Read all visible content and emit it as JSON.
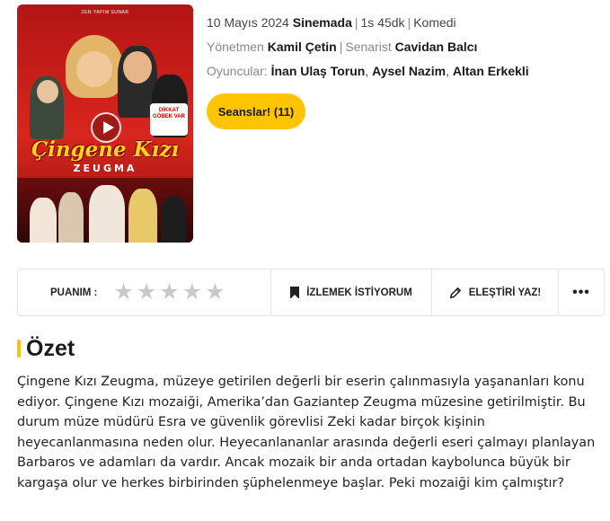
{
  "poster": {
    "title": "Çingene Kızı",
    "subtitle": "ZEUGMA",
    "top_text": "ZEN YAPIM SUNAR",
    "sign_text": "DİKKAT GÖBEK VAR"
  },
  "meta": {
    "date": "10 Mayıs 2024",
    "status": "Sinemada",
    "duration": "1s 45dk",
    "genre": "Komedi",
    "director_label": "Yönetmen",
    "director": "Kamil Çetin",
    "writer_label": "Senarist",
    "writer": "Cavidan Balcı",
    "cast_label": "Oyuncular:",
    "cast": [
      "İnan Ulaş Torun",
      "Aysel Nazim",
      "Altan Erkekli"
    ]
  },
  "showtimes_button": "Seanslar! (11)",
  "actionbar": {
    "rating_label": "PUANIM :",
    "stars": 5,
    "rating_value": 0,
    "watchlist_label": "İZLEMEK İSTİYORUM",
    "review_label": "ELEŞTİRİ YAZ!",
    "more_label": "•••"
  },
  "summary": {
    "heading": "Özet",
    "text": "Çingene Kızı Zeugma, müzeye getirilen değerli bir eserin çalınmasıyla yaşananları konu ediyor. Çingene Kızı mozaiği, Amerika’dan Gaziantep Zeugma müzesine getirilmiştir. Bu durum müze müdürü Esra ve güvenlik görevlisi Zeki kadar birçok kişinin heyecanlanmasına neden olur. Heyecanlananlar arasında değerli eseri çalmayı planlayan Barbaros ve adamları da vardır. Ancak mozaik bir anda ortadan kaybolunca büyük bir kargaşa olur ve herkes birbirinden şüphelenmeye başlar. Peki mozaiği kim çalmıştır?"
  },
  "colors": {
    "accent": "#ffc400",
    "star_empty": "#c9c9c9",
    "border": "#e3e3e3"
  }
}
